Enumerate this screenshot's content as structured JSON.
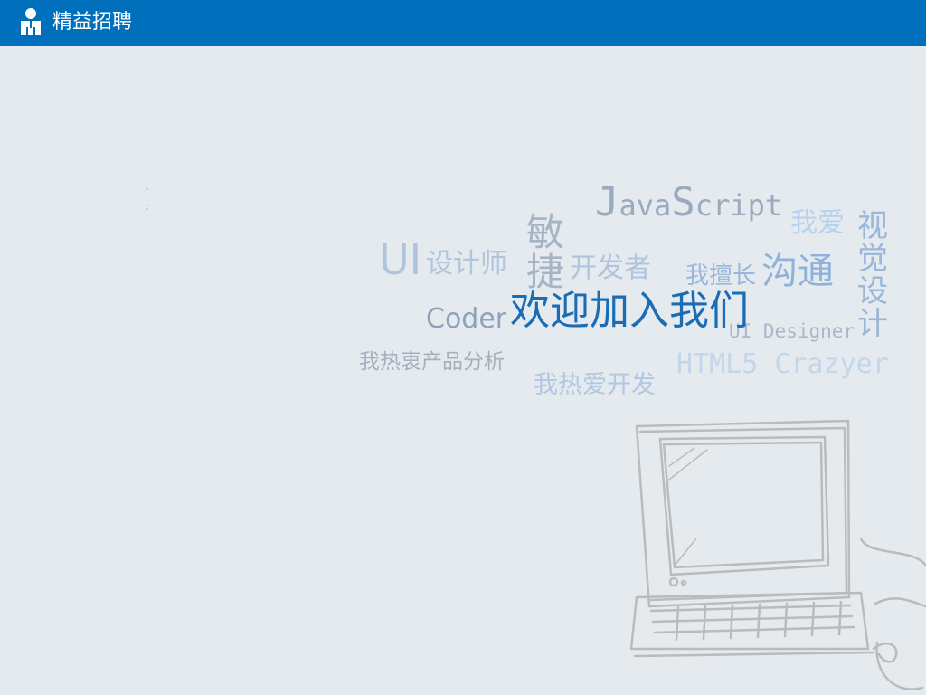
{
  "header": {
    "title": "精益招聘",
    "icon": "person-icon",
    "bg_color": "#0070bd"
  },
  "cloud": {
    "javascript": {
      "first": "J",
      "mid": "ava",
      "s": "S",
      "rest": "cript"
    },
    "ui": "UI",
    "ui_designer_cn": "设计师",
    "agile_1": "敏",
    "agile_2": "捷",
    "developer": "开发者",
    "i_love": "我爱",
    "visual_design": [
      "视",
      "觉",
      "设",
      "计"
    ],
    "good_at": "我擅长",
    "communication": "沟通",
    "coder": "Coder",
    "welcome": "欢迎加入我们",
    "ui_designer_en": "UI Designer",
    "product": "我热衷产品分析",
    "html5": "HTML5 Crazyer",
    "love_dev": "我热爱开发"
  },
  "colors": {
    "accent": "#0070bd",
    "welcome": "#1a6cb5",
    "grey_blue": "#9aabc0",
    "light_blue": "#b6cfe8"
  },
  "illustration": "computer-sketch"
}
